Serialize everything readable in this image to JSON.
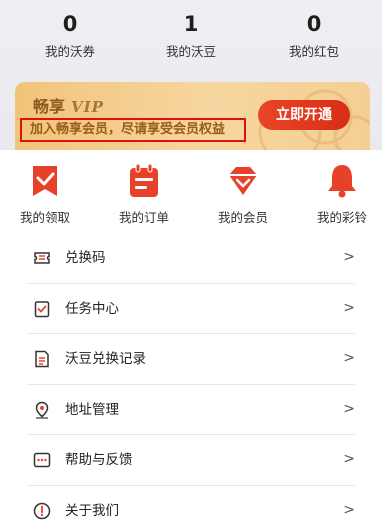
{
  "stats": [
    {
      "value": "0",
      "label": "我的沃券"
    },
    {
      "value": "1",
      "label": "我的沃豆"
    },
    {
      "value": "0",
      "label": "我的红包"
    }
  ],
  "vip_banner": {
    "title": "畅享",
    "vip_text": "VIP",
    "subtitle": "加入畅享会员，尽请享受会员权益",
    "button_label": "立即开通"
  },
  "quick_actions": [
    {
      "label": "我的领取",
      "icon": "ribbon-check-icon"
    },
    {
      "label": "我的订单",
      "icon": "order-doc-icon"
    },
    {
      "label": "我的会员",
      "icon": "diamond-crown-icon"
    },
    {
      "label": "我的彩铃",
      "icon": "bell-icon"
    }
  ],
  "menu": [
    {
      "label": "兑换码",
      "icon": "ticket-icon"
    },
    {
      "label": "任务中心",
      "icon": "task-check-icon"
    },
    {
      "label": "沃豆兑换记录",
      "icon": "record-doc-icon"
    },
    {
      "label": "地址管理",
      "icon": "location-pin-icon"
    },
    {
      "label": "帮助与反馈",
      "icon": "feedback-icon"
    },
    {
      "label": "关于我们",
      "icon": "info-icon"
    }
  ],
  "arrow_glyph": ">",
  "colors": {
    "accent_red": "#e8412a",
    "vip_gold": "#f4cf93",
    "vip_text": "#9a5b18",
    "highlight_border": "#e01010"
  }
}
